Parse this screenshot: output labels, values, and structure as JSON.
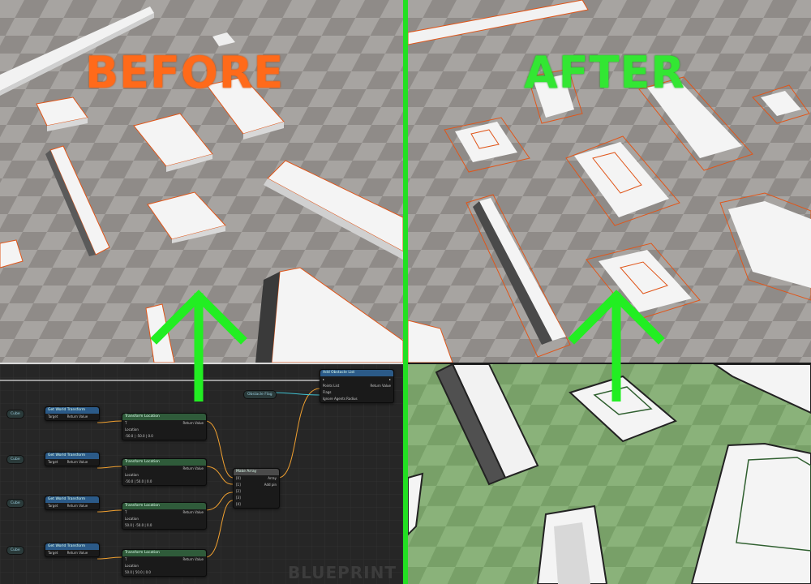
{
  "labels": {
    "before": "BEFORE",
    "after": "AFTER",
    "blueprint_watermark": "BLUEPRINT"
  },
  "colors": {
    "before_label": "#ff6a1a",
    "after_label": "#33e633",
    "divider": "#22e022",
    "outline": "#e0561a"
  },
  "blueprint": {
    "get_transform_nodes": [
      {
        "title": "Get World Transform",
        "var": "Cube",
        "target": "Target",
        "ret": "Return Value"
      },
      {
        "title": "Get World Transform",
        "var": "Cube",
        "target": "Target",
        "ret": "Return Value"
      },
      {
        "title": "Get World Transform",
        "var": "Cube",
        "target": "Target",
        "ret": "Return Value"
      },
      {
        "title": "Get World Transform",
        "var": "Cube",
        "target": "Target",
        "ret": "Return Value"
      }
    ],
    "transform_nodes": [
      {
        "title": "Transform Location",
        "ret": "Return Value",
        "loc_label": "Location",
        "loc_values": "-50.0 | -50.0 | 0.0"
      },
      {
        "title": "Transform Location",
        "ret": "Return Value",
        "loc_label": "Location",
        "loc_values": "-50.0 | 50.0 | 0.0"
      },
      {
        "title": "Transform Location",
        "ret": "Return Value",
        "loc_label": "Location",
        "loc_values": "50.0 | -50.0 | 0.0"
      },
      {
        "title": "Transform Location",
        "ret": "Return Value",
        "loc_label": "Location",
        "loc_values": "50.0 | 50.0 | 0.0"
      }
    ],
    "make_array": {
      "title": "Make Array",
      "pins": [
        "[0]",
        "[1]",
        "[2]",
        "[3]",
        "[4]"
      ],
      "out": "Array",
      "add_pin": "Add pin"
    },
    "add_obstacle": {
      "title": "Add Obstacle List",
      "points": "Points List",
      "flags": "Flags",
      "ignore": "Ignore Agents Radius",
      "ret": "Return Value"
    },
    "obstacle_var": "Obstacle Flag"
  }
}
